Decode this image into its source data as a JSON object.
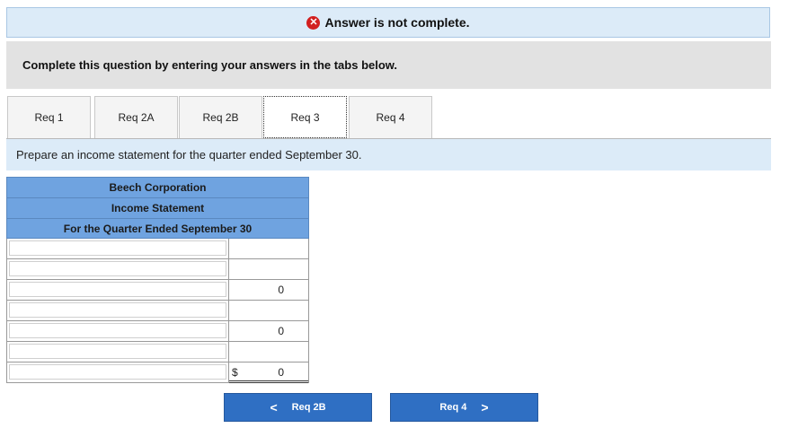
{
  "banner": {
    "icon": "x-circle-icon",
    "text": "Answer is not complete."
  },
  "instruction": "Complete this question by entering your answers in the tabs below.",
  "tabs": [
    {
      "label": "Req 1"
    },
    {
      "label": "Req 2A"
    },
    {
      "label": "Req 2B"
    },
    {
      "label": "Req 3"
    },
    {
      "label": "Req 4"
    }
  ],
  "active_tab": "Req 3",
  "prompt": "Prepare an income statement for the quarter ended September 30.",
  "statement": {
    "company": "Beech Corporation",
    "title": "Income Statement",
    "period": "For the Quarter Ended September 30",
    "rows": [
      {
        "label": "",
        "prefix": "",
        "value": ""
      },
      {
        "label": "",
        "prefix": "",
        "value": ""
      },
      {
        "label": "",
        "prefix": "",
        "value": "0"
      },
      {
        "label": "",
        "prefix": "",
        "value": ""
      },
      {
        "label": "",
        "prefix": "",
        "value": "0"
      },
      {
        "label": "",
        "prefix": "",
        "value": ""
      },
      {
        "label": "",
        "prefix": "$",
        "value": "0"
      }
    ]
  },
  "nav": {
    "prev_label": "Req 2B",
    "prev_icon": "chevron-left-icon",
    "next_label": "Req 4",
    "next_icon": "chevron-right-icon"
  },
  "colors": {
    "accent": "#2f6fc3",
    "header_fill": "#6fa3e0",
    "banner_bg": "#dcebf8",
    "error": "#d21f1f"
  }
}
